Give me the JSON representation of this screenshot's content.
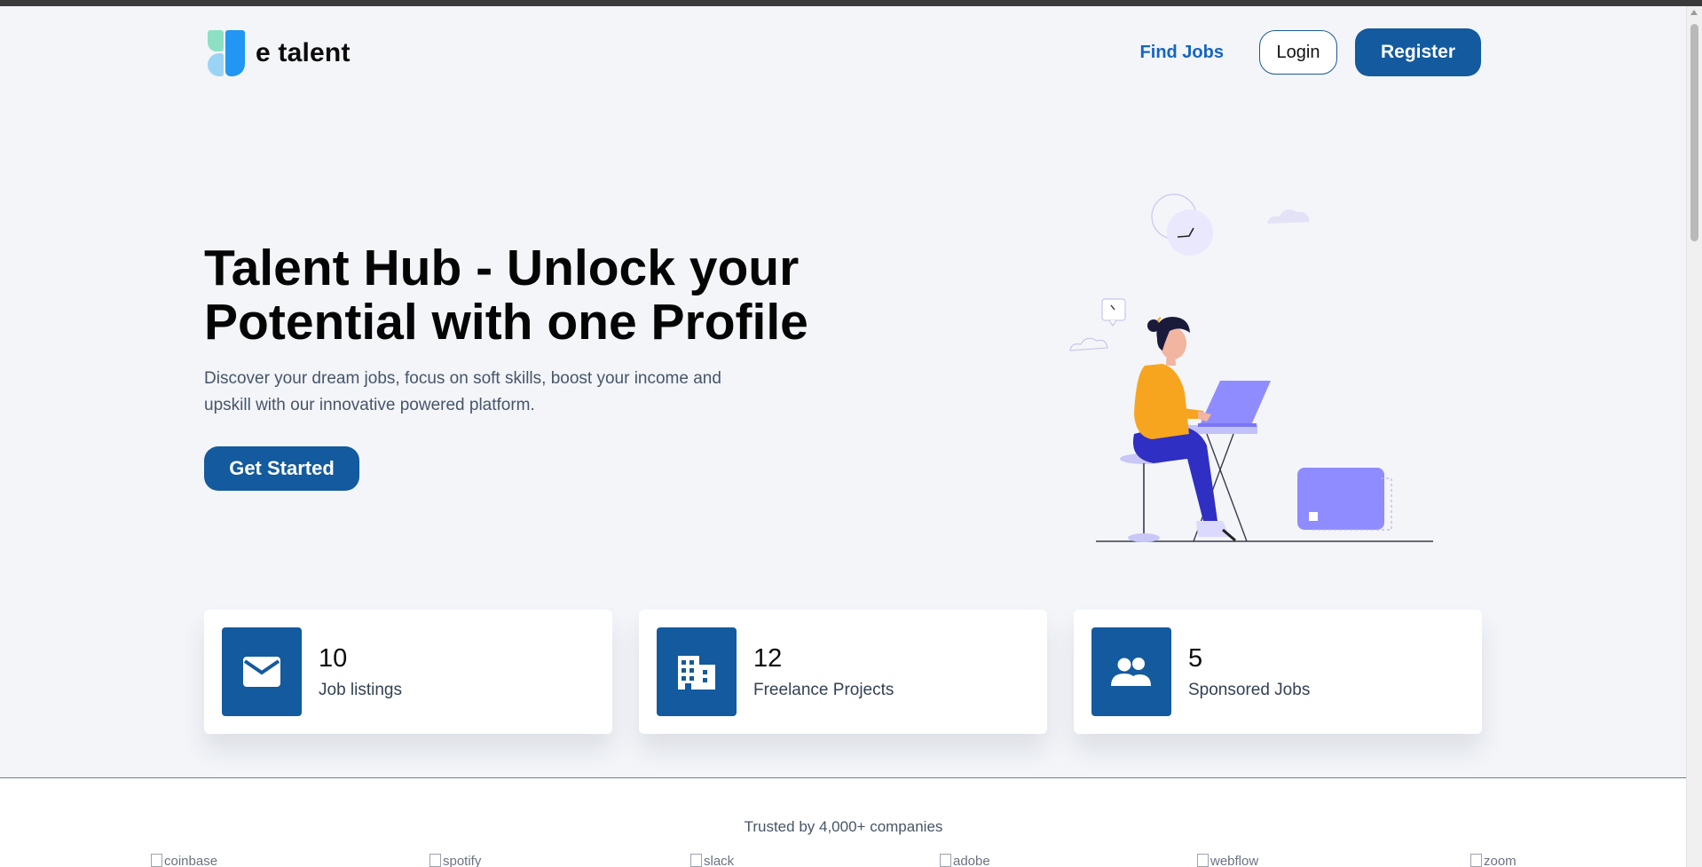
{
  "header": {
    "logo_text": "e talent",
    "nav": {
      "find_jobs": "Find Jobs",
      "login": "Login",
      "register": "Register"
    }
  },
  "hero": {
    "title": "Talent Hub - Unlock your Potential with one Profile",
    "subtitle": "Discover your dream jobs, focus on soft skills, boost your income and upskill with our innovative powered platform.",
    "cta": "Get Started",
    "illustration": "person-working-on-laptop-illustration"
  },
  "stats": [
    {
      "icon": "mail-icon",
      "value": "10",
      "label": "Job listings"
    },
    {
      "icon": "building-icon",
      "value": "12",
      "label": "Freelance Projects"
    },
    {
      "icon": "people-icon",
      "value": "5",
      "label": "Sponsored Jobs"
    }
  ],
  "trusted": {
    "text": "Trusted by 4,000+ companies",
    "brands": [
      "coinbase",
      "spotify",
      "slack",
      "adobe",
      "webflow",
      "zoom"
    ]
  },
  "colors": {
    "primary": "#135a9e",
    "link": "#1565c0",
    "background": "#f3f5f9",
    "accent_illustration": "#8f8cff"
  }
}
